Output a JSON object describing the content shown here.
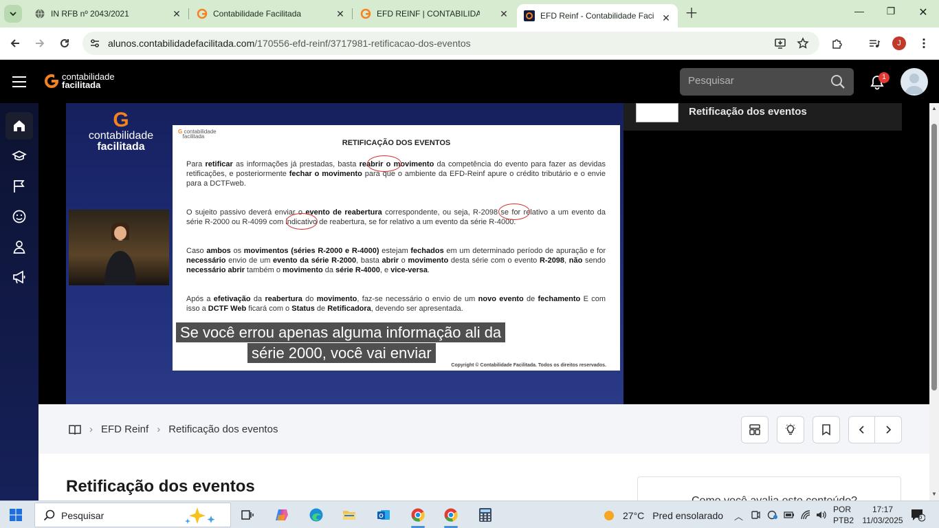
{
  "browser": {
    "tabs": [
      {
        "title": "IN RFB nº 2043/2021",
        "icon": "globe-icon"
      },
      {
        "title": "Contabilidade Facilitada",
        "icon": "cf-logo-icon"
      },
      {
        "title": "EFD REINF | CONTABILIDADE FA",
        "icon": "cf-logo-icon"
      },
      {
        "title": "EFD Reinf - Contabilidade Facilit",
        "icon": "cf-dark-logo-icon",
        "active": true
      }
    ],
    "url_domain": "alunos.contabilidadefacilitada.com",
    "url_path": "/170556-efd-reinf/3717981-retificacao-dos-eventos",
    "profile_initial": "J"
  },
  "header": {
    "logo_line1": "contabilidade",
    "logo_line2": "facilitada",
    "search_placeholder": "Pesquisar",
    "notification_count": "1"
  },
  "video": {
    "logo_line1": "contabilidade",
    "logo_line2": "facilitada",
    "slide_logo_line1": "contabilidade",
    "slide_logo_line2": "facilitada",
    "slide_title": "RETIFICAÇÃO DOS EVENTOS",
    "paragraphs": [
      "Para <b>retificar</b> as informações já prestadas, basta <b>reabrir o movimento</b> da competência do evento para fazer as devidas retificações, e posteriormente <b>fechar o movimento</b> para que o ambiente da EFD-Reinf apure o crédito tributário e o envie para a DCTFweb.",
      "O sujeito passivo deverá enviar o <b>evento de reabertura</b> correspondente, ou seja, R-2098 se for relativo a um evento da série R-2000 ou R-4099 com indicativo de reabertura, se for relativo a um evento da série R-4000.",
      "Caso <b>ambos</b> os <b>movimentos (séries R-2000 e R-4000)</b> estejam <b>fechados</b> em um determinado período de apuração e for <b>necessário</b> envio de um <b>evento da série R-2000</b>, basta <b>abrir</b> o <b>movimento</b> desta série com o evento <b>R-2098</b>, <b>não</b> sendo <b>necessário abrir</b> também o <b>movimento</b> da <b>série R-4000</b>,  e <b>vice-versa</b>.",
      "Após a <b>efetivação</b> da <b>reabertura</b> do <b>movimento</b>, faz-se necessário o envio de um <b>novo evento</b> de <b>fechamento</b> E com isso a <b>DCTF Web</b> ficará com o <b>Status</b> de <b>Retificadora</b>, devendo ser apresentada."
    ],
    "copyright": "Copyright © Contabilidade Facilitada. Todos os direitos reservados.",
    "caption_line1": "Se você errou apenas alguma informação ali da",
    "caption_line2": "série 2000, você vai enviar"
  },
  "playlist": {
    "current_title": "Retificação dos eventos"
  },
  "breadcrumb": {
    "course": "EFD Reinf",
    "lesson": "Retificação dos eventos"
  },
  "page": {
    "title": "Retificação dos eventos",
    "rating_prompt": "Como você avalia este conteúdo?"
  },
  "taskbar": {
    "search_label": "Pesquisar",
    "temperature": "27°C",
    "weather_text": "Pred ensolarado",
    "lang_line1": "POR",
    "lang_line2": "PTB2",
    "time": "17:17",
    "date": "11/03/2025",
    "notifications": "6"
  },
  "colors": {
    "brand_orange": "#f58220",
    "tab_strip": "#d7ebd1",
    "badge_red": "#e53935"
  }
}
